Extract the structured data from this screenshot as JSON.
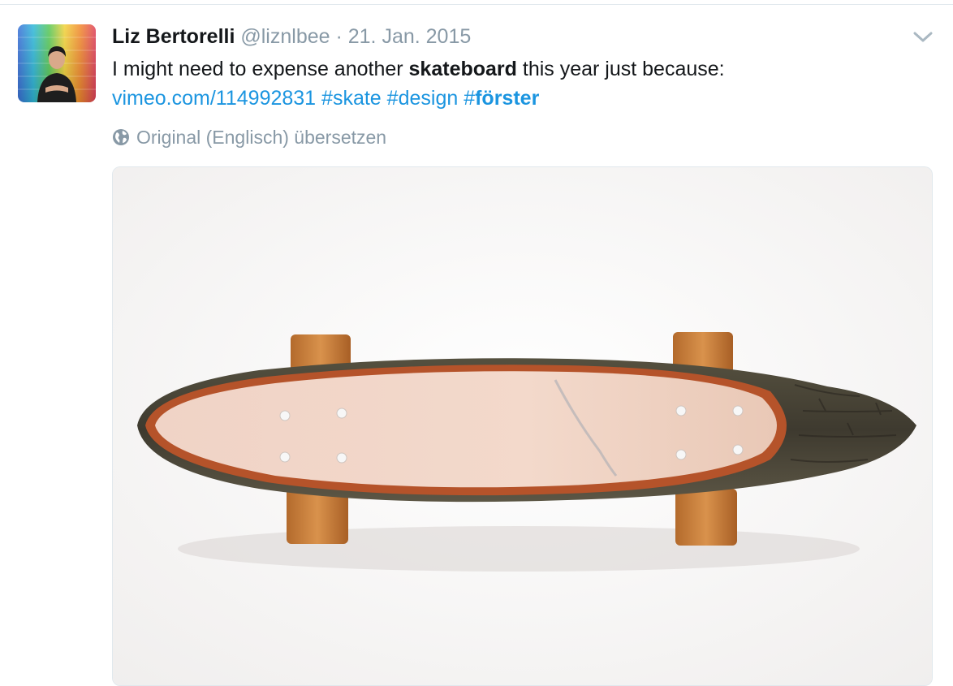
{
  "tweet": {
    "author": {
      "fullname": "Liz Bertorelli",
      "username": "@liznlbee"
    },
    "separator": " · ",
    "timestamp": "21. Jan. 2015",
    "text": {
      "line1_before": "I might need to expense another ",
      "line1_bold": "skateboard",
      "line1_after": " this year just because:",
      "link": "vimeo.com/114992831",
      "hashtag1": "#skate",
      "hashtag2": "#design",
      "hashtag3_prefix": "#",
      "hashtag3_bold": "förster"
    },
    "translate_label": "Original (Englisch) übersetzen",
    "icons": {
      "more": "chevron-down-icon",
      "translate": "globe-icon"
    },
    "colors": {
      "link": "#1b95e0",
      "muted": "#8899a6",
      "text": "#14171a"
    }
  }
}
